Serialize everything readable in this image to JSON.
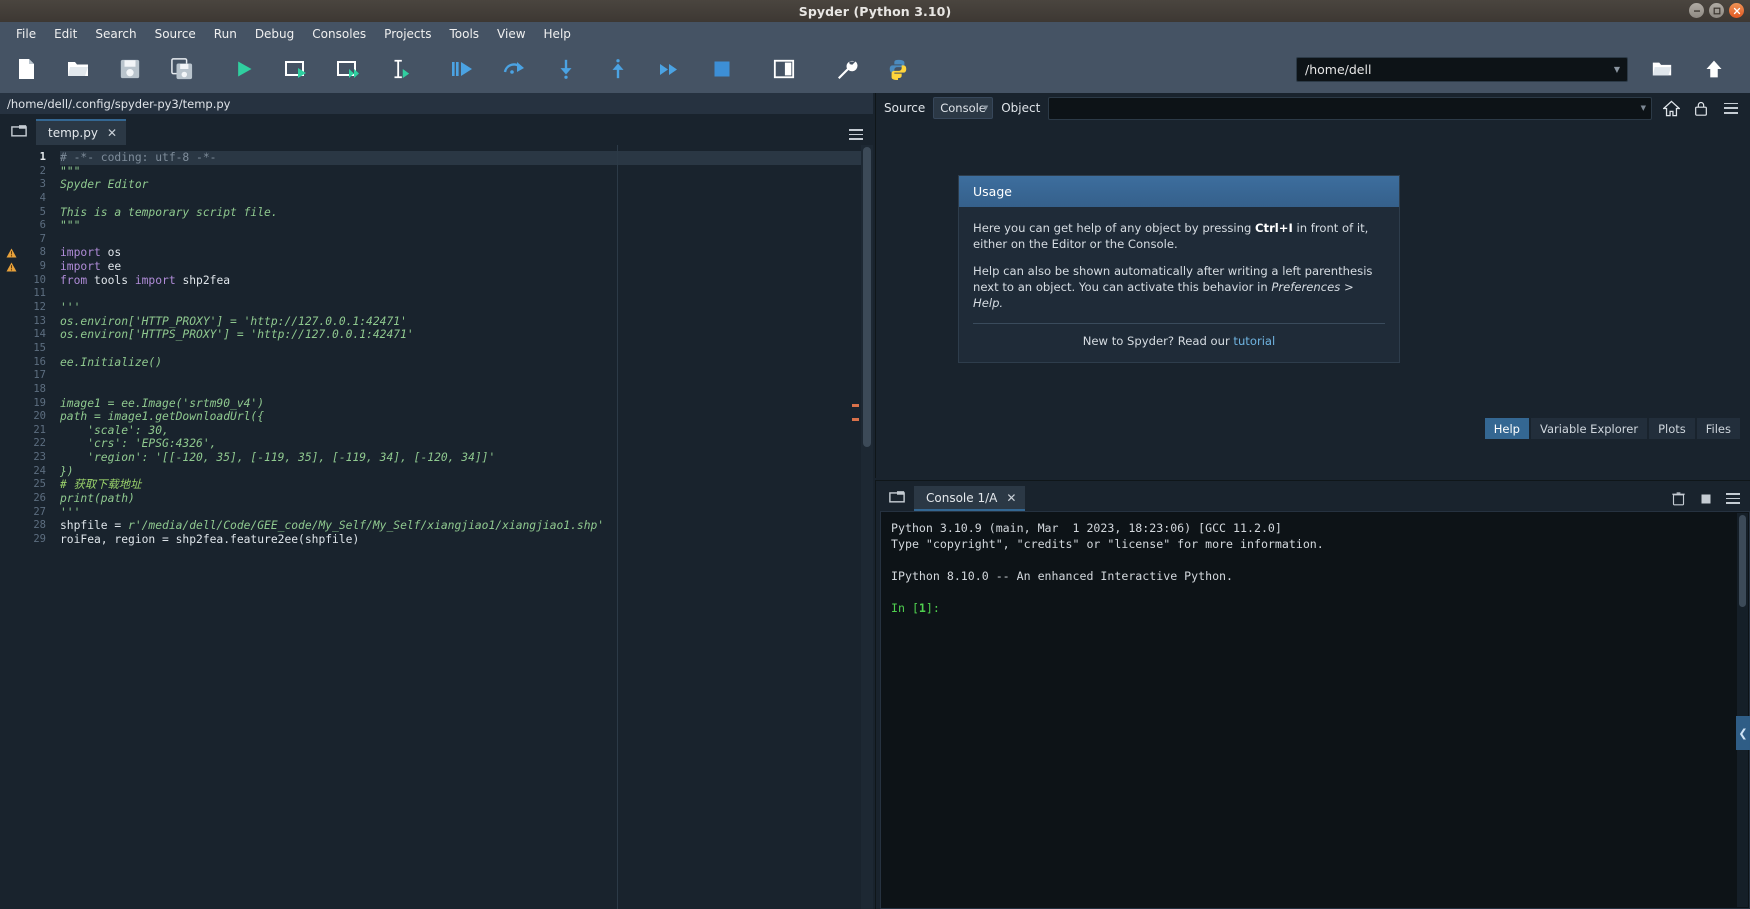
{
  "window": {
    "title": "Spyder (Python 3.10)",
    "controls": [
      {
        "name": "minimize",
        "glyph": "–"
      },
      {
        "name": "maximize",
        "glyph": "❐"
      },
      {
        "name": "close",
        "glyph": "✕"
      }
    ]
  },
  "menubar": {
    "items": [
      "File",
      "Edit",
      "Search",
      "Source",
      "Run",
      "Debug",
      "Consoles",
      "Projects",
      "Tools",
      "View",
      "Help"
    ]
  },
  "toolbar": {
    "buttons": [
      {
        "name": "new-file-icon",
        "tooltip": "New file"
      },
      {
        "name": "open-file-icon",
        "tooltip": "Open file"
      },
      {
        "name": "save-file-icon",
        "tooltip": "Save file"
      },
      {
        "name": "save-all-icon",
        "tooltip": "Save all"
      },
      {
        "name": "run-file-icon",
        "tooltip": "Run file"
      },
      {
        "name": "run-cell-icon",
        "tooltip": "Run current cell"
      },
      {
        "name": "run-cell-advance-icon",
        "tooltip": "Run current cell and go to the next one"
      },
      {
        "name": "run-selection-icon",
        "tooltip": "Run selection or current line"
      },
      {
        "name": "debug-file-icon",
        "tooltip": "Debug file"
      },
      {
        "name": "step-over-icon",
        "tooltip": "Run current line"
      },
      {
        "name": "step-into-icon",
        "tooltip": "Step into function"
      },
      {
        "name": "step-return-icon",
        "tooltip": "Run until current function returns"
      },
      {
        "name": "continue-icon",
        "tooltip": "Continue execution"
      },
      {
        "name": "stop-debug-icon",
        "tooltip": "Stop debugging"
      },
      {
        "name": "maximize-pane-icon",
        "tooltip": "Maximize current pane"
      },
      {
        "name": "preferences-icon",
        "tooltip": "Preferences"
      },
      {
        "name": "pythonpath-manager-icon",
        "tooltip": "PYTHONPATH manager"
      }
    ],
    "path_value": "/home/dell",
    "browse_label": "browse-directory-icon",
    "parent_label": "parent-directory-icon"
  },
  "editor": {
    "file_path": "/home/dell/.config/spyder-py3/temp.py",
    "tab_label": "temp.py",
    "close_glyph": "✕",
    "current_line": 1,
    "warning_lines": [
      8,
      9
    ],
    "lines": [
      {
        "n": 1,
        "tokens": [
          {
            "t": "com",
            "s": "# -*- coding: utf-8 -*-"
          }
        ]
      },
      {
        "n": 2,
        "tokens": [
          {
            "t": "str",
            "s": "\"\"\""
          }
        ]
      },
      {
        "n": 3,
        "tokens": [
          {
            "t": "str",
            "s": "Spyder Editor"
          }
        ]
      },
      {
        "n": 4,
        "tokens": [
          {
            "t": "str",
            "s": ""
          }
        ]
      },
      {
        "n": 5,
        "tokens": [
          {
            "t": "str",
            "s": "This is a temporary script file."
          }
        ]
      },
      {
        "n": 6,
        "tokens": [
          {
            "t": "str",
            "s": "\"\"\""
          }
        ]
      },
      {
        "n": 7,
        "tokens": [
          {
            "t": "nm",
            "s": ""
          }
        ]
      },
      {
        "n": 8,
        "tokens": [
          {
            "t": "kw",
            "s": "import "
          },
          {
            "t": "nm",
            "s": "os"
          }
        ]
      },
      {
        "n": 9,
        "tokens": [
          {
            "t": "kw",
            "s": "import "
          },
          {
            "t": "nm",
            "s": "ee"
          }
        ]
      },
      {
        "n": 10,
        "tokens": [
          {
            "t": "kw",
            "s": "from "
          },
          {
            "t": "nm",
            "s": "tools "
          },
          {
            "t": "kw",
            "s": "import "
          },
          {
            "t": "nm",
            "s": "shp2fea"
          }
        ]
      },
      {
        "n": 11,
        "tokens": [
          {
            "t": "nm",
            "s": ""
          }
        ]
      },
      {
        "n": 12,
        "tokens": [
          {
            "t": "str",
            "s": "'''"
          }
        ]
      },
      {
        "n": 13,
        "tokens": [
          {
            "t": "str",
            "s": "os.environ['HTTP_PROXY'] = 'http://127.0.0.1:42471'"
          }
        ]
      },
      {
        "n": 14,
        "tokens": [
          {
            "t": "str",
            "s": "os.environ['HTTPS_PROXY'] = 'http://127.0.0.1:42471'"
          }
        ]
      },
      {
        "n": 15,
        "tokens": [
          {
            "t": "str",
            "s": ""
          }
        ]
      },
      {
        "n": 16,
        "tokens": [
          {
            "t": "str",
            "s": "ee.Initialize()"
          }
        ]
      },
      {
        "n": 17,
        "tokens": [
          {
            "t": "str",
            "s": ""
          }
        ]
      },
      {
        "n": 18,
        "tokens": [
          {
            "t": "str",
            "s": ""
          }
        ]
      },
      {
        "n": 19,
        "tokens": [
          {
            "t": "str",
            "s": "image1 = ee.Image('srtm90_v4')"
          }
        ]
      },
      {
        "n": 20,
        "tokens": [
          {
            "t": "str",
            "s": "path = image1.getDownloadUrl({"
          }
        ]
      },
      {
        "n": 21,
        "tokens": [
          {
            "t": "str",
            "s": "    'scale': 30,"
          }
        ]
      },
      {
        "n": 22,
        "tokens": [
          {
            "t": "str",
            "s": "    'crs': 'EPSG:4326',"
          }
        ]
      },
      {
        "n": 23,
        "tokens": [
          {
            "t": "str",
            "s": "    'region': '[[-120, 35], [-119, 35], [-119, 34], [-120, 34]]'"
          }
        ]
      },
      {
        "n": 24,
        "tokens": [
          {
            "t": "str",
            "s": "})"
          }
        ]
      },
      {
        "n": 25,
        "tokens": [
          {
            "t": "cjk",
            "s": "# 获取下载地址"
          }
        ]
      },
      {
        "n": 26,
        "tokens": [
          {
            "t": "str",
            "s": "print(path)"
          }
        ]
      },
      {
        "n": 27,
        "tokens": [
          {
            "t": "str",
            "s": "'''"
          }
        ]
      },
      {
        "n": 28,
        "tokens": [
          {
            "t": "nm",
            "s": "shpfile = "
          },
          {
            "t": "str",
            "s": "r'/media/dell/Code/GEE_code/My_Self/My_Self/xiangjiao1/xiangjiao1.shp'"
          }
        ]
      },
      {
        "n": 29,
        "tokens": [
          {
            "t": "nm",
            "s": "roiFea, region = shp2fea.feature2ee(shpfile)"
          }
        ]
      }
    ]
  },
  "help": {
    "source_label": "Source",
    "source_value": "Console",
    "object_label": "Object",
    "object_value": "",
    "home_icon": "home-icon",
    "lock_icon": "lock-icon",
    "options_icon": "options-menu-icon",
    "card_title": "Usage",
    "paragraph1_pre": "Here you can get help of any object by pressing ",
    "paragraph1_kbd": "Ctrl+I",
    "paragraph1_post": " in front of it, either on the Editor or the Console.",
    "paragraph2_pre": "Help can also be shown automatically after writing a left parenthesis next to an object. You can activate this behavior in ",
    "paragraph2_em": "Preferences > Help.",
    "footer_pre": "New to Spyder? Read our ",
    "footer_link": "tutorial",
    "tabs": [
      {
        "label": "Help",
        "active": true
      },
      {
        "label": "Variable Explorer",
        "active": false
      },
      {
        "label": "Plots",
        "active": false
      },
      {
        "label": "Files",
        "active": false
      }
    ]
  },
  "console": {
    "browse_icon": "browse-tabs-icon",
    "tab_label": "Console 1/A",
    "close_glyph": "✕",
    "remove_icon": "remove-all-variables-icon",
    "stop_icon": "interrupt-kernel-icon",
    "options_icon": "options-menu-icon",
    "lines": [
      {
        "type": "out",
        "text": "Python 3.10.9 (main, Mar  1 2023, 18:23:06) [GCC 11.2.0]"
      },
      {
        "type": "out",
        "text": "Type \"copyright\", \"credits\" or \"license\" for more information."
      },
      {
        "type": "blank",
        "text": ""
      },
      {
        "type": "out",
        "text": "IPython 8.10.0 -- An enhanced Interactive Python."
      },
      {
        "type": "blank",
        "text": ""
      }
    ],
    "prompt_prefix": "In [",
    "prompt_number": "1",
    "prompt_suffix": "]:"
  },
  "collapse_handle": {
    "glyph": "❮",
    "name": "collapse-panel-handle"
  },
  "colors": {
    "accent": "#346792",
    "background": "#19232d",
    "toolbar": "#455364",
    "titlebar": "#3d3833",
    "string": "#8fc98f",
    "keyword": "#b08cd8",
    "comment": "#7e8c9a",
    "prompt_green": "#4fd04f",
    "close_button": "#e25822"
  }
}
